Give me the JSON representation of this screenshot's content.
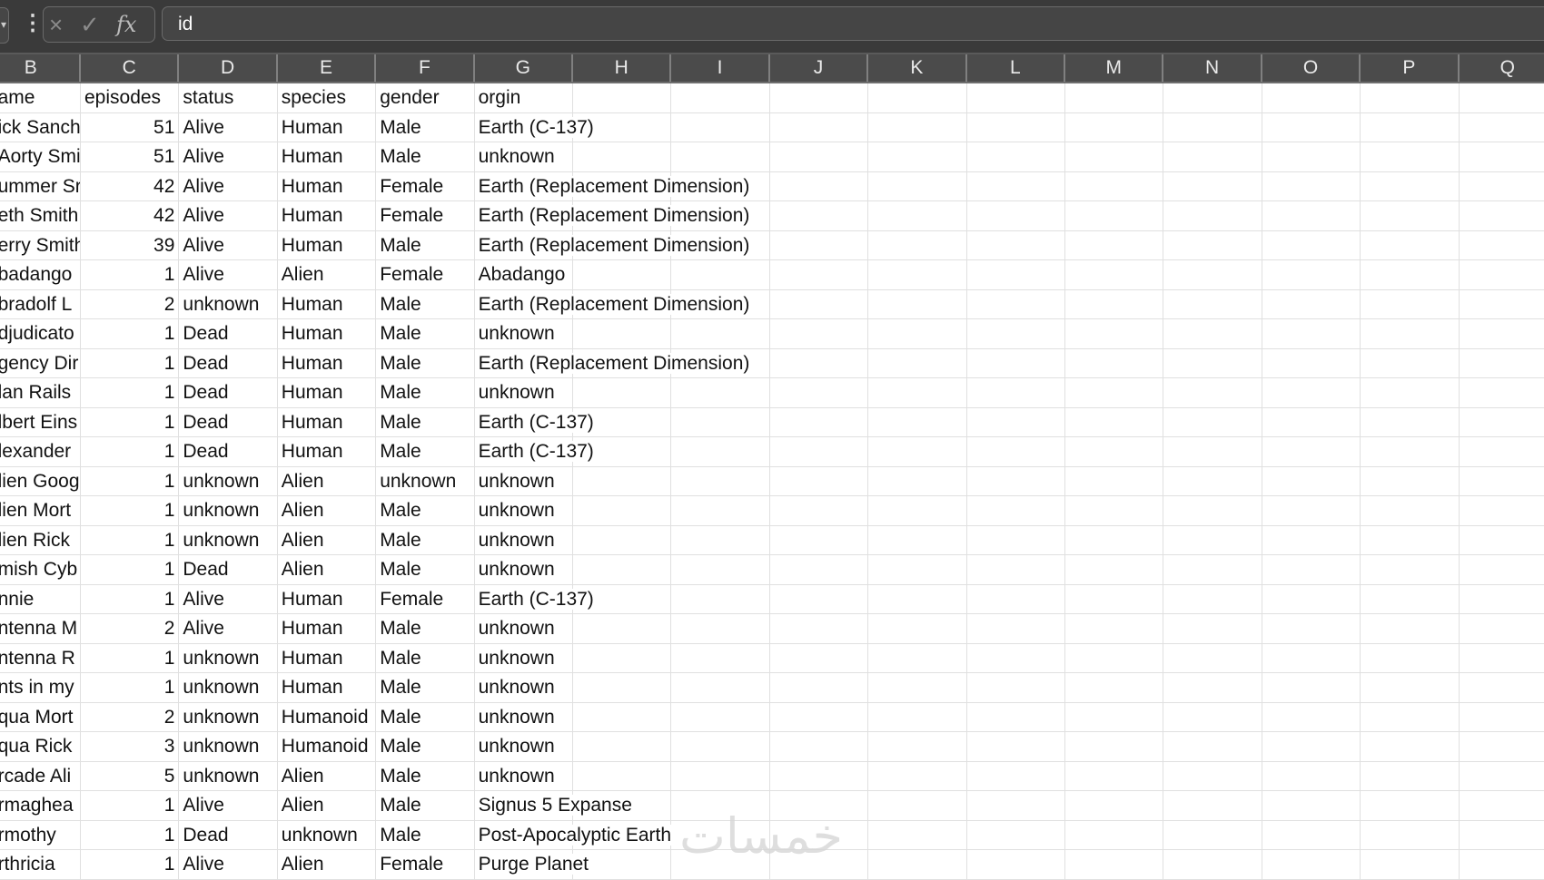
{
  "formula_bar": {
    "value": "id",
    "cancel_icon": "×",
    "enter_icon": "✓",
    "fx_label": "fx"
  },
  "columns": [
    "B",
    "C",
    "D",
    "E",
    "F",
    "G",
    "H",
    "I",
    "J",
    "K",
    "L",
    "M",
    "N",
    "O",
    "P",
    "Q"
  ],
  "rows": [
    [
      "ame",
      "episodes",
      "status",
      "species",
      "gender",
      "orgin"
    ],
    [
      "ick Sanch",
      "51",
      "Alive",
      "Human",
      "Male",
      "Earth (C-137)"
    ],
    [
      "Aorty Smi",
      "51",
      "Alive",
      "Human",
      "Male",
      "unknown"
    ],
    [
      "ummer Sr",
      "42",
      "Alive",
      "Human",
      "Female",
      "Earth (Replacement Dimension)"
    ],
    [
      "eth Smith",
      "42",
      "Alive",
      "Human",
      "Female",
      "Earth (Replacement Dimension)"
    ],
    [
      "erry Smith",
      "39",
      "Alive",
      "Human",
      "Male",
      "Earth (Replacement Dimension)"
    ],
    [
      "badango",
      "1",
      "Alive",
      "Alien",
      "Female",
      "Abadango"
    ],
    [
      "bradolf L",
      "2",
      "unknown",
      "Human",
      "Male",
      "Earth (Replacement Dimension)"
    ],
    [
      "djudicato",
      "1",
      "Dead",
      "Human",
      "Male",
      "unknown"
    ],
    [
      "gency Dir",
      "1",
      "Dead",
      "Human",
      "Male",
      "Earth (Replacement Dimension)"
    ],
    [
      "lan Rails",
      "1",
      "Dead",
      "Human",
      "Male",
      "unknown"
    ],
    [
      "lbert Eins",
      "1",
      "Dead",
      "Human",
      "Male",
      "Earth (C-137)"
    ],
    [
      "lexander",
      "1",
      "Dead",
      "Human",
      "Male",
      "Earth (C-137)"
    ],
    [
      "lien Goog",
      "1",
      "unknown",
      "Alien",
      "unknown",
      "unknown"
    ],
    [
      "lien Mort",
      "1",
      "unknown",
      "Alien",
      "Male",
      "unknown"
    ],
    [
      "lien Rick",
      "1",
      "unknown",
      "Alien",
      "Male",
      "unknown"
    ],
    [
      "mish Cyb",
      "1",
      "Dead",
      "Alien",
      "Male",
      "unknown"
    ],
    [
      "nnie",
      "1",
      "Alive",
      "Human",
      "Female",
      "Earth (C-137)"
    ],
    [
      "ntenna M",
      "2",
      "Alive",
      "Human",
      "Male",
      "unknown"
    ],
    [
      "ntenna R",
      "1",
      "unknown",
      "Human",
      "Male",
      "unknown"
    ],
    [
      "nts in my",
      "1",
      "unknown",
      "Human",
      "Male",
      "unknown"
    ],
    [
      "qua Mort",
      "2",
      "unknown",
      "Humanoid",
      "Male",
      "unknown"
    ],
    [
      "qua Rick",
      "3",
      "unknown",
      "Humanoid",
      "Male",
      "unknown"
    ],
    [
      "rcade Ali",
      "5",
      "unknown",
      "Alien",
      "Male",
      "unknown"
    ],
    [
      "rmaghea",
      "1",
      "Alive",
      "Alien",
      "Male",
      "Signus 5 Expanse"
    ],
    [
      "rmothy",
      "1",
      "Dead",
      "unknown",
      "Male",
      "Post-Apocalyptic Earth"
    ],
    [
      "rthricia",
      "1",
      "Alive",
      "Alien",
      "Female",
      "Purge Planet"
    ],
    [
      "",
      "",
      "",
      "",
      "",
      ""
    ]
  ],
  "watermark": "خمسات"
}
